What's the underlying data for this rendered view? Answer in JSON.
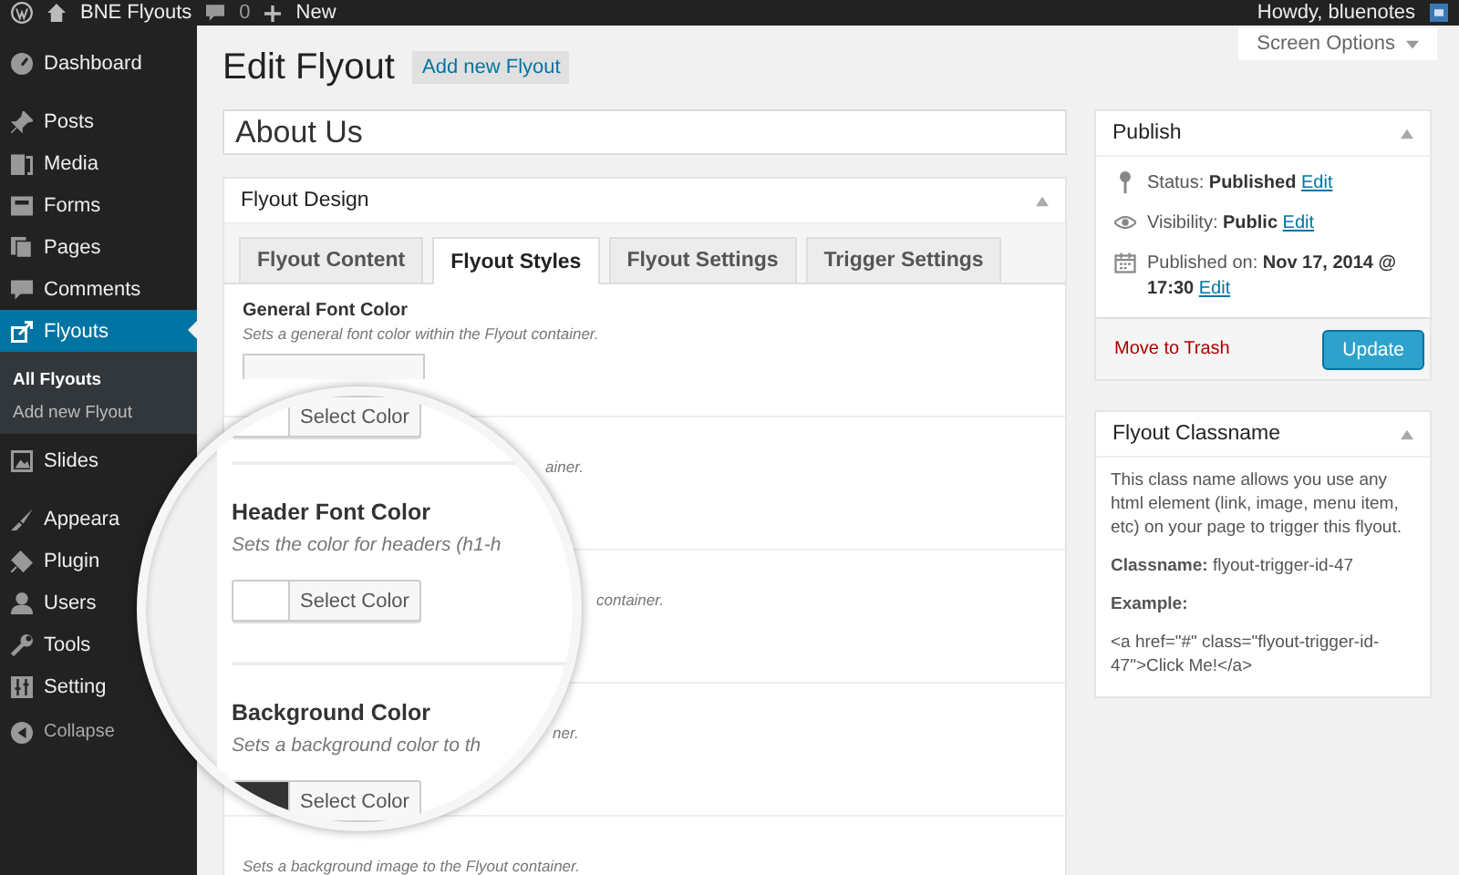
{
  "admin_bar": {
    "site_name": "BNE Flyouts",
    "comment_count": "0",
    "new_label": "New",
    "greeting": "Howdy, bluenotes"
  },
  "sidebar": {
    "items": [
      {
        "label": "Dashboard",
        "selected": false
      },
      {
        "label": "Posts",
        "selected": false
      },
      {
        "label": "Media",
        "selected": false
      },
      {
        "label": "Forms",
        "selected": false
      },
      {
        "label": "Pages",
        "selected": false
      },
      {
        "label": "Comments",
        "selected": false
      },
      {
        "label": "Flyouts",
        "selected": true,
        "children": [
          {
            "label": "All Flyouts",
            "selected": true
          },
          {
            "label": "Add new Flyout",
            "selected": false
          }
        ]
      },
      {
        "label": "Slides",
        "selected": false
      },
      {
        "label": "Appeara",
        "selected": false
      },
      {
        "label": "Plugin",
        "selected": false
      },
      {
        "label": "Users",
        "selected": false
      },
      {
        "label": "Tools",
        "selected": false
      },
      {
        "label": "Setting",
        "selected": false
      }
    ],
    "collapse": "Collapse"
  },
  "screen_options": "Screen Options",
  "page_title": "Edit Flyout",
  "add_new_button": "Add new Flyout",
  "title_field": {
    "value": "About Us"
  },
  "design_box": {
    "title": "Flyout Design",
    "tabs": [
      {
        "label": "Flyout Content",
        "selected": false
      },
      {
        "label": "Flyout Styles",
        "selected": true
      },
      {
        "label": "Flyout Settings",
        "selected": false
      },
      {
        "label": "Trigger Settings",
        "selected": false
      }
    ],
    "sections": [
      {
        "title": "General Font Color",
        "description": "Sets a general font color within the Flyout container."
      },
      {
        "description": "ainer."
      },
      {
        "description": "container."
      },
      {
        "description": "ner."
      },
      {
        "description": "Sets a background image to the Flyout container."
      }
    ]
  },
  "magnifier": {
    "fields": [
      {
        "kind": "button",
        "button": "Select Color",
        "color": "#ffffff"
      },
      {
        "kind": "field",
        "title": "Header Font Color",
        "description": "Sets the color for headers (h1-h",
        "button": "Select Color",
        "color": "#ffffff"
      },
      {
        "kind": "field",
        "title": "Background Color",
        "description": "Sets a background color to th",
        "button": "Select Color",
        "color": "#333333"
      }
    ]
  },
  "publish": {
    "title": "Publish",
    "rows": [
      {
        "text": "Status: **Published**",
        "link": "Edit"
      },
      {
        "text": "Visibility: **Public**",
        "link": "Edit"
      },
      {
        "text": "Published on: **Nov 17, 2014 @ 17:30**",
        "link": "Edit"
      }
    ],
    "trash_link": "Move to Trash",
    "update_button": "Update"
  },
  "classname_box": {
    "title": "Flyout Classname",
    "intro": "This class name allows you use any html element (link, image, menu item, etc) on your page to trigger this flyout.",
    "classname": "**Classname:** flyout-trigger-id-47",
    "example_label": "Example:",
    "example_code": "<a href=\"#\" class=\"flyout-trigger-id-47\">Click Me!</a>"
  }
}
